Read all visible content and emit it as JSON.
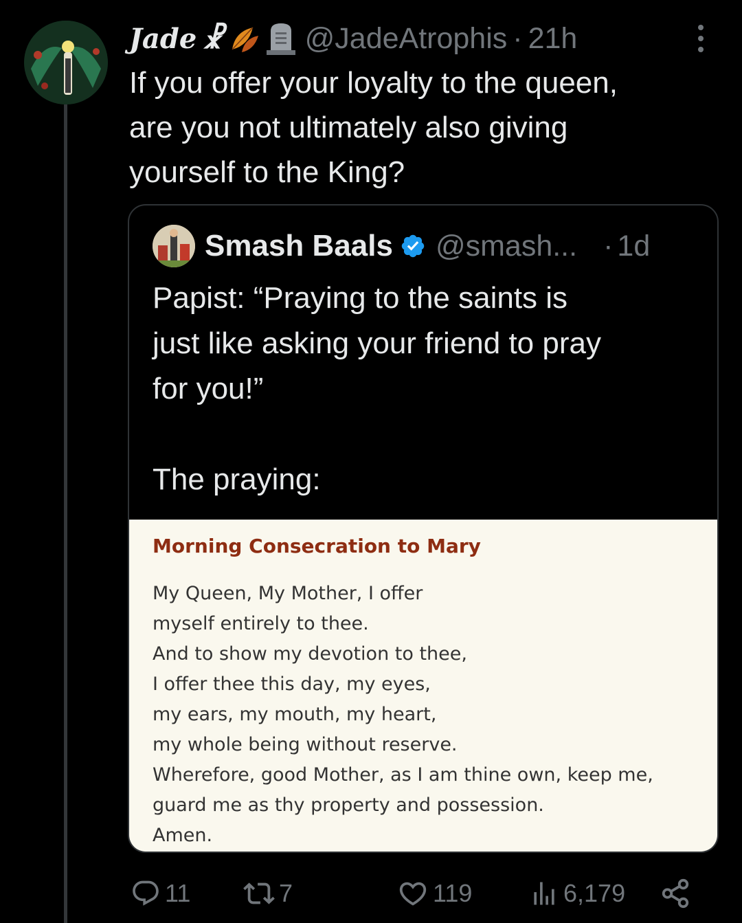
{
  "tweet": {
    "display_name": "Jade",
    "display_name_glyph": "☧",
    "emoji_1": "leaves-icon",
    "emoji_2": "headstone-icon",
    "handle": "@JadeAtrophis",
    "separator": "·",
    "time": "21h",
    "text_lines": [
      "If you offer your loyalty to the queen,",
      "are you not ultimately also giving",
      "yourself to the King?"
    ]
  },
  "quote": {
    "display_name": "Smash Baals",
    "handle": "@smash...",
    "separator": "·",
    "time": "1d",
    "text_lines": [
      "Papist: “Praying to the saints is",
      "just like asking your friend to pray",
      "for you!”",
      "",
      "The praying:"
    ],
    "image": {
      "title": "Morning Consecration to Mary",
      "lines": [
        "My Queen, My Mother, I offer",
        "myself entirely to thee.",
        "And to show my devotion to thee,",
        "I offer thee this day, my eyes,",
        "my ears, my mouth, my heart,",
        "my whole being without reserve.",
        "Wherefore, good Mother, as I am thine own, keep me,",
        "guard me as thy property and possession.",
        "Amen."
      ]
    }
  },
  "actions": {
    "replies": "11",
    "reposts": "7",
    "likes": "119",
    "views": "6,179"
  },
  "colors": {
    "background": "#000000",
    "text": "#e7e9ea",
    "muted": "#71767b",
    "verified": "#1d9bf0",
    "prayer_title": "#8e2d12"
  }
}
